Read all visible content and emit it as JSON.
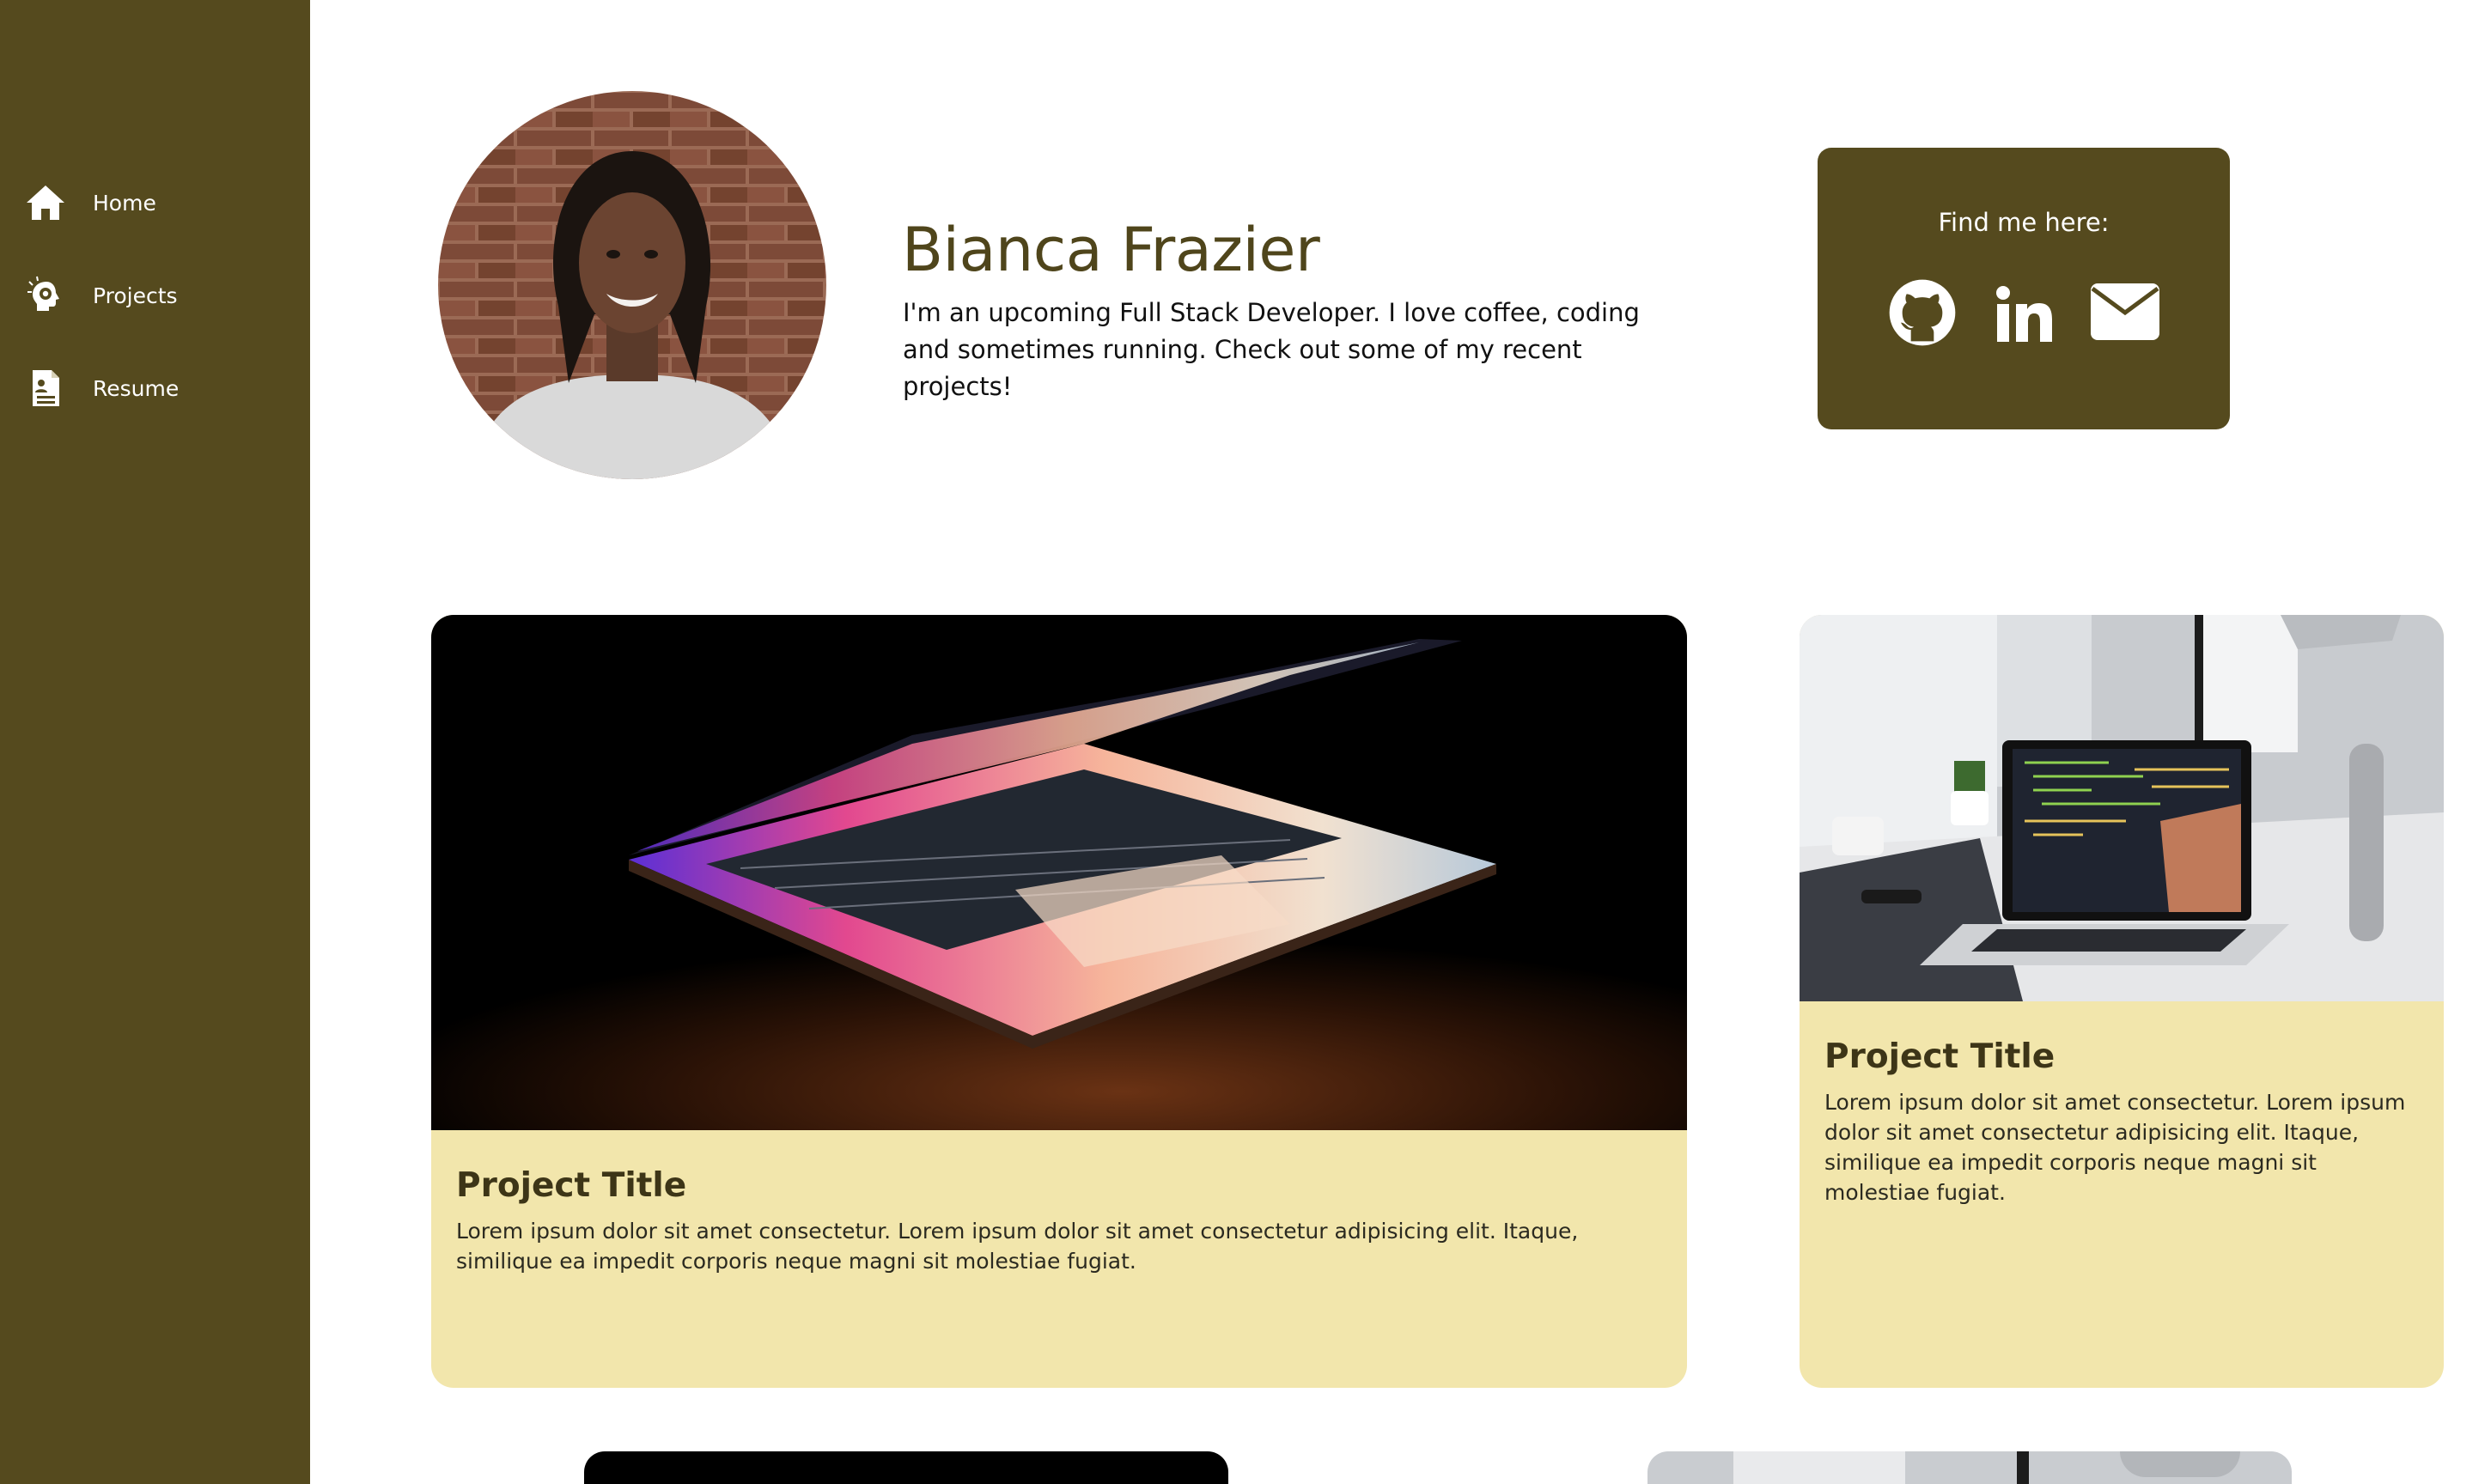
{
  "sidebar": {
    "items": [
      {
        "label": "Home",
        "icon": "home-icon"
      },
      {
        "label": "Projects",
        "icon": "projects-icon"
      },
      {
        "label": "Resume",
        "icon": "resume-icon"
      }
    ]
  },
  "hero": {
    "name": "Bianca Frazier",
    "bio": "I'm an upcoming Full Stack Developer. I love coffee, coding and sometimes running. Check out some of my recent projects!"
  },
  "contact": {
    "title": "Find me here:",
    "links": [
      "github-icon",
      "linkedin-icon",
      "mail-icon"
    ]
  },
  "projects": [
    {
      "title": "Project Title",
      "description": "Lorem ipsum dolor sit amet consectetur. Lorem ipsum dolor sit amet consectetur adipisicing elit. Itaque, similique ea impedit corporis neque magni sit molestiae fugiat."
    },
    {
      "title": "Project Title",
      "description": "Lorem ipsum dolor sit amet consectetur. Lorem ipsum dolor sit amet consectetur adipisicing elit. Itaque, similique ea impedit corporis neque magni sit molestiae fugiat."
    }
  ],
  "colors": {
    "sidebar": "#554a1e",
    "card_body": "#f2e6ac",
    "heading": "#4f451b",
    "background": "#ffffff"
  }
}
